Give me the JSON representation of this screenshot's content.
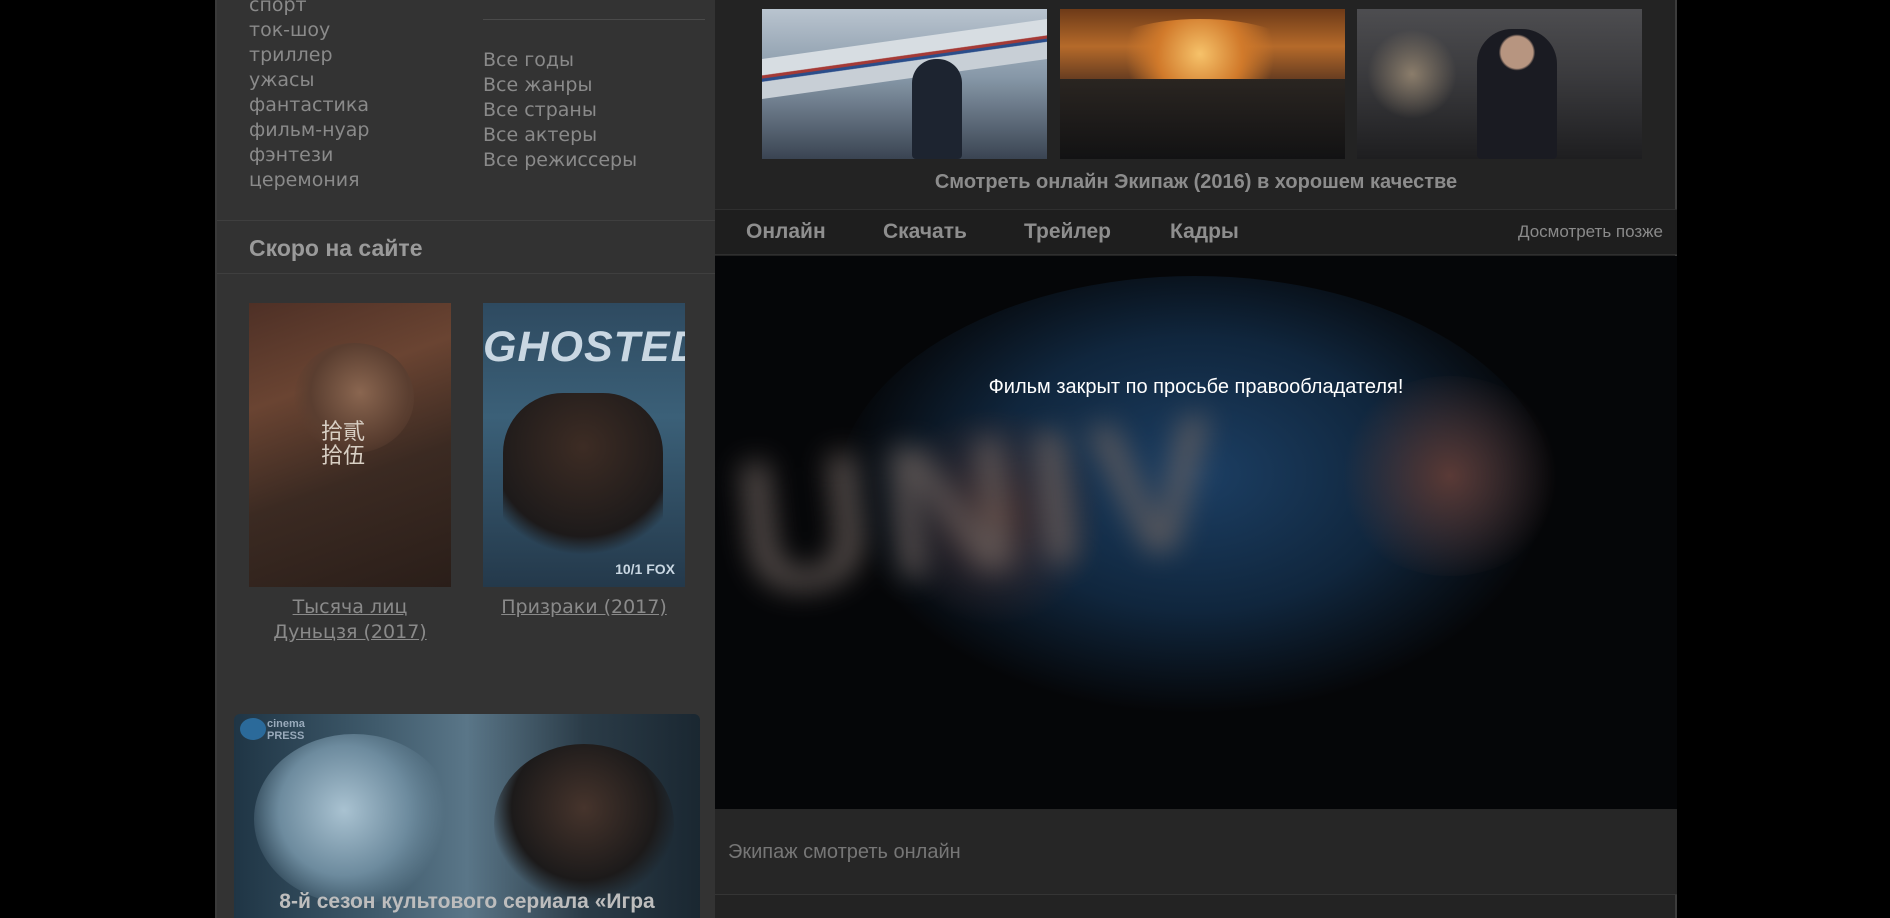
{
  "sidebar": {
    "genres": [
      "спорт",
      "ток-шоу",
      "триллер",
      "ужасы",
      "фантастика",
      "фильм-нуар",
      "фэнтези",
      "церемония"
    ],
    "all_links": [
      "Все годы",
      "Все жанры",
      "Все страны",
      "Все актеры",
      "Все режиссеры"
    ],
    "soon_title": "Скоро на сайте",
    "soon_items": [
      {
        "title": "Тысяча лиц Дуньцзя (2017)",
        "poster_text": "拾貳\n拾伍"
      },
      {
        "title": "Призраки (2017)",
        "poster_text": "GHOSTED",
        "poster_badge": "10/1 FOX"
      }
    ],
    "promo": {
      "logo_text": "cinema\nPRESS",
      "caption": "8-й сезон культового сериала «Игра"
    }
  },
  "main": {
    "watch_title": "Смотреть онлайн Экипаж (2016) в хорошем качестве",
    "tabs": [
      "Онлайн",
      "Скачать",
      "Трейлер",
      "Кадры"
    ],
    "watch_later": "Досмотреть позже",
    "player_message": "Фильм закрыт по просьбе правообладателя!",
    "player_backdrop_text": "UNIV",
    "description_title": "Экипаж смотреть онлайн"
  },
  "colors": {
    "page_bg": "#000000",
    "sidebar_bg": "#333333",
    "main_bg": "#232323",
    "text_muted": "#8a8a8a",
    "player_text": "#ffffff"
  }
}
